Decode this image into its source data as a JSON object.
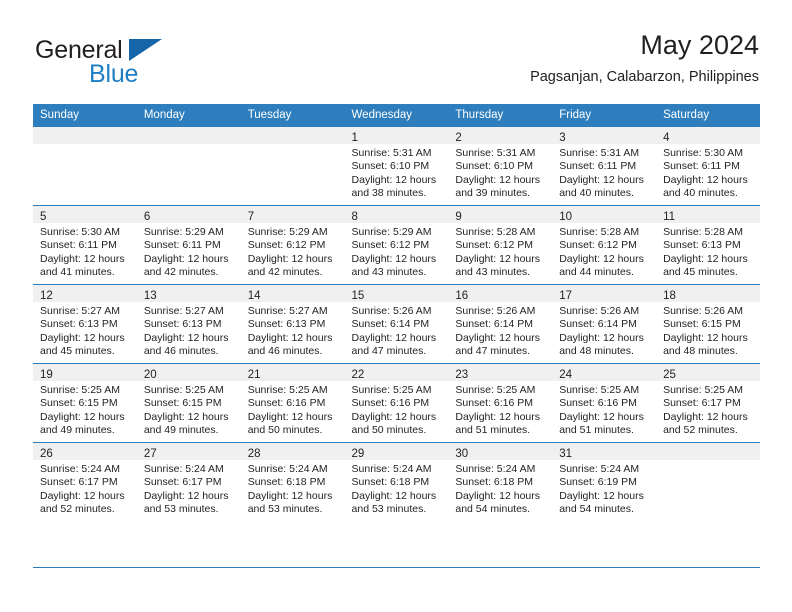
{
  "brand": {
    "name_part1": "General",
    "name_part2": "Blue",
    "logo_icon": "triangle-logo-icon"
  },
  "header": {
    "month_title": "May 2024",
    "location": "Pagsanjan, Calabarzon, Philippines"
  },
  "calendar": {
    "weekday_headers": [
      "Sunday",
      "Monday",
      "Tuesday",
      "Wednesday",
      "Thursday",
      "Friday",
      "Saturday"
    ],
    "weeks": [
      [
        {
          "day": "",
          "lines": []
        },
        {
          "day": "",
          "lines": []
        },
        {
          "day": "",
          "lines": []
        },
        {
          "day": "1",
          "lines": [
            "Sunrise: 5:31 AM",
            "Sunset: 6:10 PM",
            "Daylight: 12 hours",
            "and 38 minutes."
          ]
        },
        {
          "day": "2",
          "lines": [
            "Sunrise: 5:31 AM",
            "Sunset: 6:10 PM",
            "Daylight: 12 hours",
            "and 39 minutes."
          ]
        },
        {
          "day": "3",
          "lines": [
            "Sunrise: 5:31 AM",
            "Sunset: 6:11 PM",
            "Daylight: 12 hours",
            "and 40 minutes."
          ]
        },
        {
          "day": "4",
          "lines": [
            "Sunrise: 5:30 AM",
            "Sunset: 6:11 PM",
            "Daylight: 12 hours",
            "and 40 minutes."
          ]
        }
      ],
      [
        {
          "day": "5",
          "lines": [
            "Sunrise: 5:30 AM",
            "Sunset: 6:11 PM",
            "Daylight: 12 hours",
            "and 41 minutes."
          ]
        },
        {
          "day": "6",
          "lines": [
            "Sunrise: 5:29 AM",
            "Sunset: 6:11 PM",
            "Daylight: 12 hours",
            "and 42 minutes."
          ]
        },
        {
          "day": "7",
          "lines": [
            "Sunrise: 5:29 AM",
            "Sunset: 6:12 PM",
            "Daylight: 12 hours",
            "and 42 minutes."
          ]
        },
        {
          "day": "8",
          "lines": [
            "Sunrise: 5:29 AM",
            "Sunset: 6:12 PM",
            "Daylight: 12 hours",
            "and 43 minutes."
          ]
        },
        {
          "day": "9",
          "lines": [
            "Sunrise: 5:28 AM",
            "Sunset: 6:12 PM",
            "Daylight: 12 hours",
            "and 43 minutes."
          ]
        },
        {
          "day": "10",
          "lines": [
            "Sunrise: 5:28 AM",
            "Sunset: 6:12 PM",
            "Daylight: 12 hours",
            "and 44 minutes."
          ]
        },
        {
          "day": "11",
          "lines": [
            "Sunrise: 5:28 AM",
            "Sunset: 6:13 PM",
            "Daylight: 12 hours",
            "and 45 minutes."
          ]
        }
      ],
      [
        {
          "day": "12",
          "lines": [
            "Sunrise: 5:27 AM",
            "Sunset: 6:13 PM",
            "Daylight: 12 hours",
            "and 45 minutes."
          ]
        },
        {
          "day": "13",
          "lines": [
            "Sunrise: 5:27 AM",
            "Sunset: 6:13 PM",
            "Daylight: 12 hours",
            "and 46 minutes."
          ]
        },
        {
          "day": "14",
          "lines": [
            "Sunrise: 5:27 AM",
            "Sunset: 6:13 PM",
            "Daylight: 12 hours",
            "and 46 minutes."
          ]
        },
        {
          "day": "15",
          "lines": [
            "Sunrise: 5:26 AM",
            "Sunset: 6:14 PM",
            "Daylight: 12 hours",
            "and 47 minutes."
          ]
        },
        {
          "day": "16",
          "lines": [
            "Sunrise: 5:26 AM",
            "Sunset: 6:14 PM",
            "Daylight: 12 hours",
            "and 47 minutes."
          ]
        },
        {
          "day": "17",
          "lines": [
            "Sunrise: 5:26 AM",
            "Sunset: 6:14 PM",
            "Daylight: 12 hours",
            "and 48 minutes."
          ]
        },
        {
          "day": "18",
          "lines": [
            "Sunrise: 5:26 AM",
            "Sunset: 6:15 PM",
            "Daylight: 12 hours",
            "and 48 minutes."
          ]
        }
      ],
      [
        {
          "day": "19",
          "lines": [
            "Sunrise: 5:25 AM",
            "Sunset: 6:15 PM",
            "Daylight: 12 hours",
            "and 49 minutes."
          ]
        },
        {
          "day": "20",
          "lines": [
            "Sunrise: 5:25 AM",
            "Sunset: 6:15 PM",
            "Daylight: 12 hours",
            "and 49 minutes."
          ]
        },
        {
          "day": "21",
          "lines": [
            "Sunrise: 5:25 AM",
            "Sunset: 6:16 PM",
            "Daylight: 12 hours",
            "and 50 minutes."
          ]
        },
        {
          "day": "22",
          "lines": [
            "Sunrise: 5:25 AM",
            "Sunset: 6:16 PM",
            "Daylight: 12 hours",
            "and 50 minutes."
          ]
        },
        {
          "day": "23",
          "lines": [
            "Sunrise: 5:25 AM",
            "Sunset: 6:16 PM",
            "Daylight: 12 hours",
            "and 51 minutes."
          ]
        },
        {
          "day": "24",
          "lines": [
            "Sunrise: 5:25 AM",
            "Sunset: 6:16 PM",
            "Daylight: 12 hours",
            "and 51 minutes."
          ]
        },
        {
          "day": "25",
          "lines": [
            "Sunrise: 5:25 AM",
            "Sunset: 6:17 PM",
            "Daylight: 12 hours",
            "and 52 minutes."
          ]
        }
      ],
      [
        {
          "day": "26",
          "lines": [
            "Sunrise: 5:24 AM",
            "Sunset: 6:17 PM",
            "Daylight: 12 hours",
            "and 52 minutes."
          ]
        },
        {
          "day": "27",
          "lines": [
            "Sunrise: 5:24 AM",
            "Sunset: 6:17 PM",
            "Daylight: 12 hours",
            "and 53 minutes."
          ]
        },
        {
          "day": "28",
          "lines": [
            "Sunrise: 5:24 AM",
            "Sunset: 6:18 PM",
            "Daylight: 12 hours",
            "and 53 minutes."
          ]
        },
        {
          "day": "29",
          "lines": [
            "Sunrise: 5:24 AM",
            "Sunset: 6:18 PM",
            "Daylight: 12 hours",
            "and 53 minutes."
          ]
        },
        {
          "day": "30",
          "lines": [
            "Sunrise: 5:24 AM",
            "Sunset: 6:18 PM",
            "Daylight: 12 hours",
            "and 54 minutes."
          ]
        },
        {
          "day": "31",
          "lines": [
            "Sunrise: 5:24 AM",
            "Sunset: 6:19 PM",
            "Daylight: 12 hours",
            "and 54 minutes."
          ]
        },
        {
          "day": "",
          "lines": []
        }
      ]
    ]
  },
  "colors": {
    "header_blue": "#2e7ebd",
    "brand_blue": "#1e7fc4",
    "logo_blue": "#1565a8",
    "daynum_band": "#f0f0f0",
    "text": "#231f20"
  }
}
